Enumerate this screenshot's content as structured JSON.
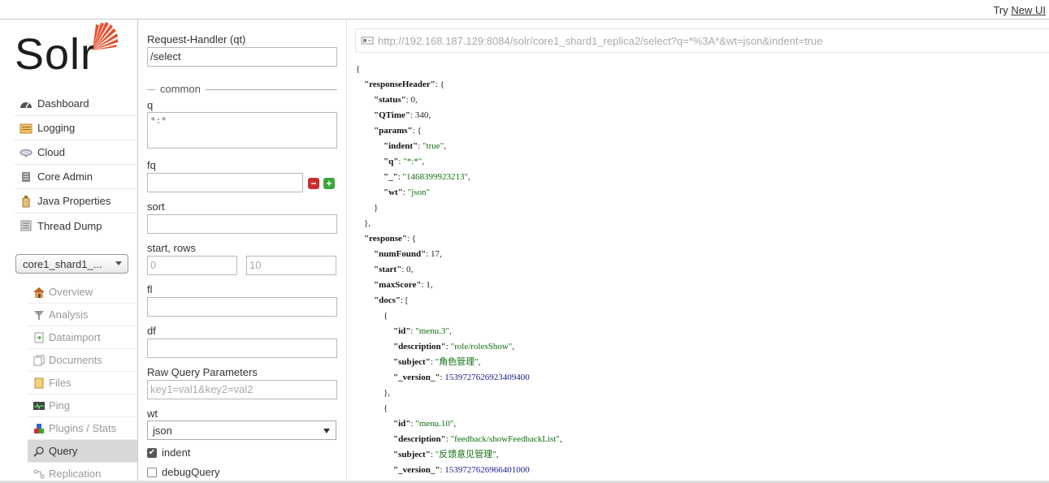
{
  "topbar": {
    "try_prefix": "Try",
    "new_ui_link": "New UI"
  },
  "logo": {
    "text": "Solr"
  },
  "nav": {
    "items": [
      {
        "label": "Dashboard",
        "icon": "dashboard-icon"
      },
      {
        "label": "Logging",
        "icon": "logging-icon"
      },
      {
        "label": "Cloud",
        "icon": "cloud-icon"
      },
      {
        "label": "Core Admin",
        "icon": "core-admin-icon"
      },
      {
        "label": "Java Properties",
        "icon": "java-properties-icon"
      },
      {
        "label": "Thread Dump",
        "icon": "thread-dump-icon"
      }
    ],
    "core_selector": "core1_shard1_...",
    "core_items": [
      {
        "label": "Overview",
        "icon": "house-icon",
        "active": false
      },
      {
        "label": "Analysis",
        "icon": "funnel-icon",
        "active": false
      },
      {
        "label": "Dataimport",
        "icon": "dataimport-icon",
        "active": false
      },
      {
        "label": "Documents",
        "icon": "documents-icon",
        "active": false
      },
      {
        "label": "Files",
        "icon": "file-icon",
        "active": false
      },
      {
        "label": "Ping",
        "icon": "ping-icon",
        "active": false
      },
      {
        "label": "Plugins / Stats",
        "icon": "plugins-icon",
        "active": false
      },
      {
        "label": "Query",
        "icon": "magnifier-icon",
        "active": true
      },
      {
        "label": "Replication",
        "icon": "replication-icon",
        "active": false
      }
    ]
  },
  "form": {
    "request_handler_label": "Request-Handler (qt)",
    "request_handler_value": "/select",
    "common_label": "common",
    "q_label": "q",
    "q_value": "*:*",
    "fq_label": "fq",
    "fq_value": "",
    "sort_label": "sort",
    "sort_value": "",
    "start_rows_label": "start, rows",
    "start_placeholder": "0",
    "rows_placeholder": "10",
    "fl_label": "fl",
    "fl_value": "",
    "df_label": "df",
    "df_value": "",
    "raw_label": "Raw Query Parameters",
    "raw_placeholder": "key1=val1&key2=val2",
    "wt_label": "wt",
    "wt_value": "json",
    "indent_label": "indent",
    "indent_checked": true,
    "debug_label": "debugQuery",
    "debug_checked": false
  },
  "result": {
    "url": "http://192.168.187.129:8084/solr/core1_shard1_replica2/select?q=*%3A*&wt=json&indent=true",
    "response_header": {
      "status": 0,
      "QTime": 340,
      "params": {
        "indent": "true",
        "q": "*:*",
        "_": "1468399923213",
        "wt": "json"
      }
    },
    "response": {
      "numFound": 17,
      "start": 0,
      "maxScore": 1,
      "docs": [
        {
          "id": "menu.3",
          "description": "role/rolesShow",
          "subject": "角色管理",
          "_version_": "1539727626923409400"
        },
        {
          "id": "menu.10",
          "description": "feedback/showFeedbackList",
          "subject": "反馈意见管理",
          "_version_": "1539727626966401000"
        }
      ]
    }
  }
}
